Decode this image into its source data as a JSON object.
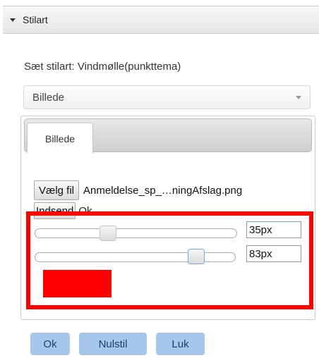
{
  "panel": {
    "title": "Stilart"
  },
  "style_label": "Sæt stilart: Vindmølle(punkttema)",
  "style_select": {
    "value": "Billede"
  },
  "tabs": [
    {
      "label": "Billede"
    }
  ],
  "file_upload": {
    "choose_button": "Vælg fil",
    "file_name": "Anmeldelse_sp_…ningAfslag.png",
    "submit_button": "Indsend",
    "status": "Ok"
  },
  "sliders": [
    {
      "value": "35px",
      "fraction": 0.35
    },
    {
      "value": "83px",
      "fraction": 0.83
    }
  ],
  "color_swatch": {
    "color": "#ff0000"
  },
  "footer": {
    "ok": "Ok",
    "reset": "Nulstil",
    "close": "Luk"
  },
  "colors": {
    "highlight": "#ff0000",
    "primary_button": "#a7c6ec"
  }
}
